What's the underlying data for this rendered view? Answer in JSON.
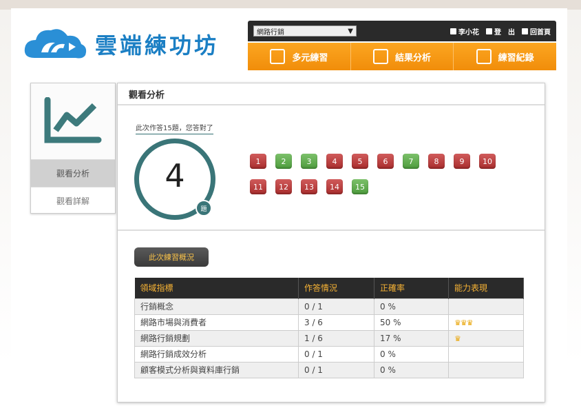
{
  "brand": {
    "name": "雲端練功坊"
  },
  "topbar": {
    "select_value": "網路行銷",
    "user": "李小花",
    "logout": "登　出",
    "home": "回首頁"
  },
  "nav": [
    {
      "label": "多元練習",
      "icon": "calendar-icon"
    },
    {
      "label": "結果分析",
      "icon": "document-icon"
    },
    {
      "label": "練習紀錄",
      "icon": "edit-icon"
    }
  ],
  "sidebar": {
    "icon": "line-chart-icon",
    "items": [
      {
        "label": "觀看分析",
        "active": true
      },
      {
        "label": "觀看詳解",
        "active": false
      }
    ]
  },
  "main": {
    "title": "觀看分析",
    "summary": "此次作答15題，您答對了",
    "correct_count": "4",
    "unit": "題",
    "questions": [
      {
        "n": "1",
        "correct": false
      },
      {
        "n": "2",
        "correct": true
      },
      {
        "n": "3",
        "correct": true
      },
      {
        "n": "4",
        "correct": false
      },
      {
        "n": "5",
        "correct": false
      },
      {
        "n": "6",
        "correct": false
      },
      {
        "n": "7",
        "correct": true
      },
      {
        "n": "8",
        "correct": false
      },
      {
        "n": "9",
        "correct": false
      },
      {
        "n": "10",
        "correct": false
      },
      {
        "n": "11",
        "correct": false
      },
      {
        "n": "12",
        "correct": false
      },
      {
        "n": "13",
        "correct": false
      },
      {
        "n": "14",
        "correct": false
      },
      {
        "n": "15",
        "correct": true
      }
    ],
    "overview_label": "此次練習概況",
    "table": {
      "headers": [
        "領域指標",
        "作答情況",
        "正確率",
        "能力表現"
      ],
      "rows": [
        {
          "domain": "行銷概念",
          "answered": "0 / 1",
          "rate": "0 %",
          "crowns": 0
        },
        {
          "domain": "網路市場與消費者",
          "answered": "3 / 6",
          "rate": "50 %",
          "crowns": 3
        },
        {
          "domain": "網路行銷規劃",
          "answered": "1 / 6",
          "rate": "17 %",
          "crowns": 1
        },
        {
          "domain": "網路行銷成效分析",
          "answered": "0 / 1",
          "rate": "0 %",
          "crowns": 0
        },
        {
          "domain": "顧客模式分析與資料庫行銷",
          "answered": "0 / 1",
          "rate": "0 %",
          "crowns": 0
        }
      ]
    }
  },
  "colors": {
    "accent": "#f39a14",
    "teal": "#3a7578",
    "wrong": "#b83a3a",
    "right": "#5aa84a"
  }
}
